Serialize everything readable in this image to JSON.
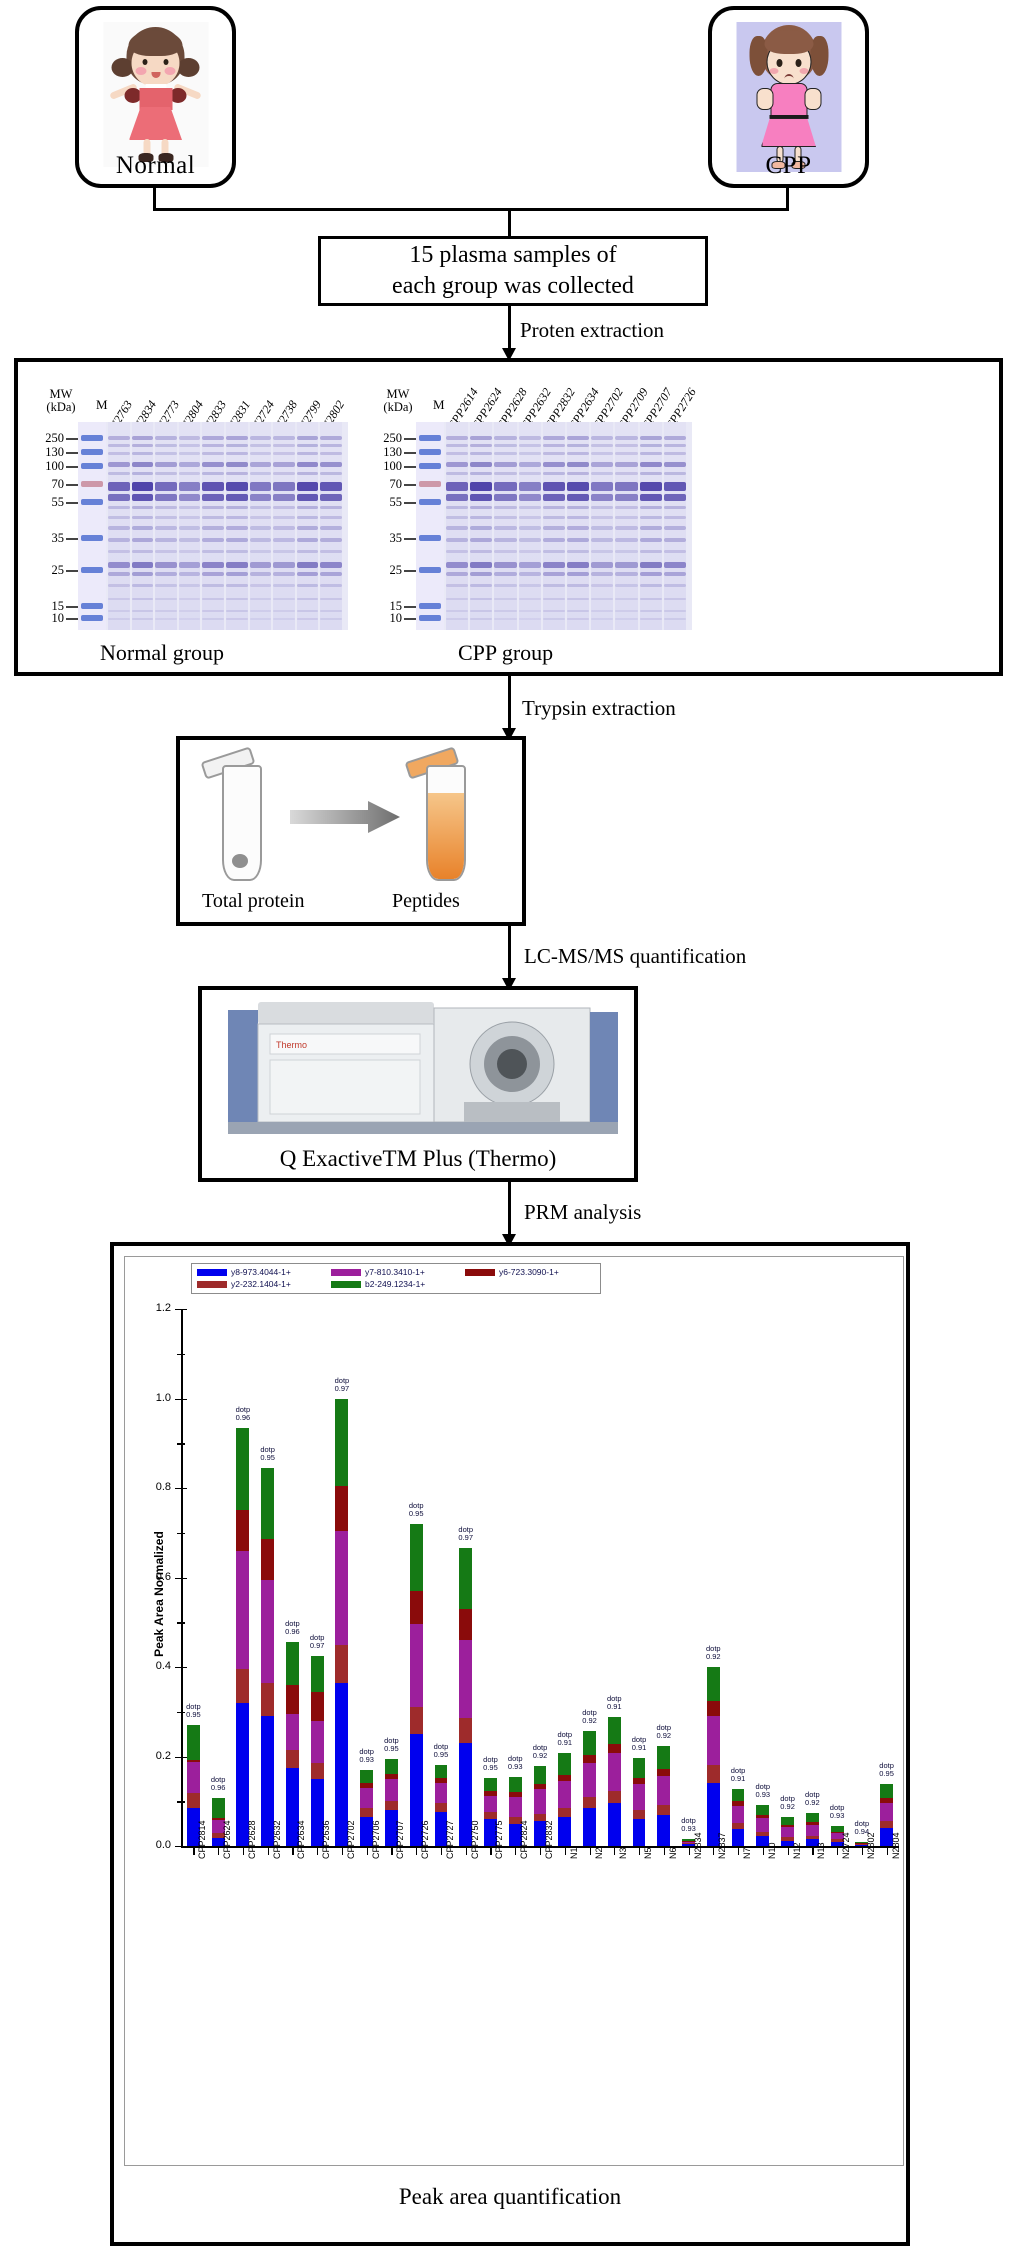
{
  "groups": {
    "normal": {
      "label": "Normal"
    },
    "cpp": {
      "label": "CPP"
    }
  },
  "collection_box": {
    "line1": "15 plasma samples of",
    "line2": "each group was collected"
  },
  "steps": {
    "protein_extraction": "Proten extraction",
    "trypsin_extraction": "Trypsin extraction",
    "lcmsms": "LC-MS/MS quantification",
    "prm": "PRM analysis"
  },
  "gel": {
    "mw_header_line1": "MW",
    "mw_header_line2": "(kDa)",
    "marker_label": "M",
    "ladder": [
      "250",
      "130",
      "100",
      "70",
      "55",
      "35",
      "25",
      "15",
      "10"
    ],
    "normal_caption": "Normal group",
    "cpp_caption": "CPP group",
    "normal_lanes": [
      "N2763",
      "N2834",
      "N2773",
      "N2804",
      "N2833",
      "N2831",
      "N2724",
      "N2738",
      "N2799",
      "N2802"
    ],
    "cpp_lanes": [
      "CPP2614",
      "CPP2624",
      "CPP2628",
      "CPP2632",
      "CPP2832",
      "CPP2634",
      "CPP2702",
      "CPP2709",
      "CPP2707",
      "CPP2726"
    ]
  },
  "tube_panel": {
    "left_label": "Total protein",
    "right_label": "Peptides"
  },
  "instrument": {
    "label": "Q ExactiveTM Plus (Thermo)"
  },
  "chart_caption": "Peak area quantification",
  "chart_data": {
    "type": "bar",
    "stacked": true,
    "title": "",
    "xlabel": "",
    "ylabel": "Peak Area Normalized",
    "ylim": [
      0,
      1.2
    ],
    "yticks": [
      "0.0",
      "0.2",
      "0.4",
      "0.6",
      "0.8",
      "1.0",
      "1.2"
    ],
    "grid": false,
    "legend_position": "top-left",
    "series": [
      {
        "name": "y8-973.4044-1+",
        "color": "#0000ee"
      },
      {
        "name": "y2-232.1404-1+",
        "color": "#9e2b2b"
      },
      {
        "name": "y7-810.3410-1+",
        "color": "#9c1f9c"
      },
      {
        "name": "b2-249.1234-1+",
        "color": "#157a15"
      },
      {
        "name": "y6-723.3090-1+",
        "color": "#8a0b0b"
      }
    ],
    "categories": [
      "CPP2814",
      "CPP2624",
      "CPP2628",
      "CPP2632",
      "CPP2634",
      "CPP2636",
      "CPP2702",
      "CPP2706",
      "CPP2707",
      "CPP2726",
      "CPP2727",
      "CPP2750",
      "CPP2775",
      "CPP2824",
      "CPP2832",
      "N1",
      "N2",
      "N3",
      "N5",
      "N6",
      "N2834",
      "N2837",
      "N7",
      "N10",
      "N12",
      "N13",
      "N2724",
      "N2802",
      "N2804"
    ],
    "dotp_labels": [
      "0.95",
      "0.96",
      "0.96",
      "0.95",
      "0.96",
      "0.97",
      "0.97",
      "0.93",
      "0.95",
      "0.95",
      "0.95",
      "0.97",
      "0.95",
      "0.93",
      "0.92",
      "0.91",
      "0.92",
      "0.91",
      "0.91",
      "0.92",
      "0.93",
      "0.92",
      "0.91",
      "0.93",
      "0.92",
      "0.92",
      "0.93",
      "0.94",
      "0.95"
    ],
    "stack_values": [
      [
        0.085,
        0.033,
        0.07,
        0.077,
        0.005
      ],
      [
        0.018,
        0.01,
        0.03,
        0.045,
        0.005
      ],
      [
        0.32,
        0.075,
        0.265,
        0.185,
        0.09
      ],
      [
        0.29,
        0.075,
        0.23,
        0.16,
        0.09
      ],
      [
        0.175,
        0.04,
        0.08,
        0.095,
        0.065
      ],
      [
        0.15,
        0.035,
        0.095,
        0.08,
        0.065
      ],
      [
        0.365,
        0.085,
        0.255,
        0.195,
        0.1
      ],
      [
        0.065,
        0.02,
        0.045,
        0.03,
        0.01
      ],
      [
        0.08,
        0.02,
        0.05,
        0.035,
        0.01
      ],
      [
        0.25,
        0.06,
        0.185,
        0.15,
        0.075
      ],
      [
        0.075,
        0.02,
        0.045,
        0.03,
        0.012
      ],
      [
        0.23,
        0.055,
        0.175,
        0.135,
        0.07
      ],
      [
        0.06,
        0.017,
        0.035,
        0.03,
        0.01
      ],
      [
        0.05,
        0.015,
        0.045,
        0.035,
        0.01
      ],
      [
        0.055,
        0.017,
        0.055,
        0.04,
        0.012
      ],
      [
        0.065,
        0.02,
        0.06,
        0.048,
        0.014
      ],
      [
        0.085,
        0.025,
        0.075,
        0.055,
        0.018
      ],
      [
        0.095,
        0.028,
        0.085,
        0.06,
        0.02
      ],
      [
        0.06,
        0.02,
        0.058,
        0.045,
        0.014
      ],
      [
        0.07,
        0.022,
        0.065,
        0.05,
        0.016
      ],
      [
        0.005,
        0.002,
        0.004,
        0.004,
        0.001
      ],
      [
        0.14,
        0.04,
        0.11,
        0.075,
        0.035
      ],
      [
        0.038,
        0.014,
        0.038,
        0.028,
        0.01
      ],
      [
        0.022,
        0.01,
        0.03,
        0.022,
        0.007
      ],
      [
        0.012,
        0.008,
        0.022,
        0.018,
        0.005
      ],
      [
        0.015,
        0.008,
        0.025,
        0.02,
        0.006
      ],
      [
        0.01,
        0.006,
        0.012,
        0.012,
        0.004
      ],
      [
        0.003,
        0.001,
        0.002,
        0.002,
        0.001
      ],
      [
        0.04,
        0.016,
        0.04,
        0.032,
        0.011
      ]
    ]
  }
}
